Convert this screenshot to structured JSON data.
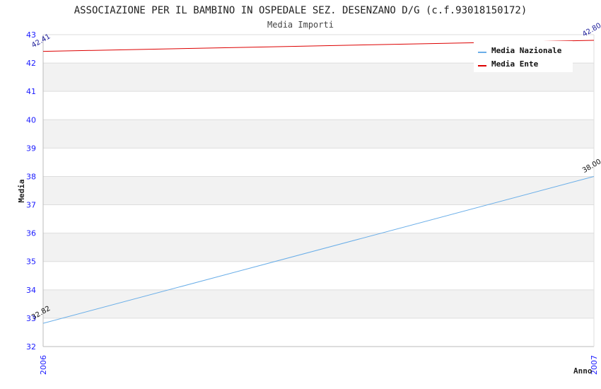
{
  "chart_data": {
    "type": "line",
    "title": "ASSOCIAZIONE PER IL BAMBINO IN OSPEDALE SEZ. DESENZANO D/G (c.f.93018150172)",
    "subtitle": "Media Importi",
    "xlabel": "Anno",
    "ylabel": "Media",
    "x": [
      "2006",
      "2007"
    ],
    "ylim": [
      32,
      43
    ],
    "yticks": [
      32,
      33,
      34,
      35,
      36,
      37,
      38,
      39,
      40,
      41,
      42,
      43
    ],
    "grid": true,
    "legend_position": "top-right",
    "series": [
      {
        "name": "Media Nazionale",
        "values": [
          32.82,
          38.0
        ],
        "labels": [
          "32.82",
          "38.00"
        ],
        "color": "#6aaee8",
        "label_color": "#111111"
      },
      {
        "name": "Media Ente",
        "values": [
          42.41,
          42.8
        ],
        "labels": [
          "42.41",
          "42.80"
        ],
        "color": "#dd0000",
        "label_color": "#1a1a99"
      }
    ]
  },
  "colors": {
    "band": "#f2f2f2",
    "grid": "#dddddd",
    "axis": "#bbbbbb",
    "tick_text": "#1a1aff"
  }
}
